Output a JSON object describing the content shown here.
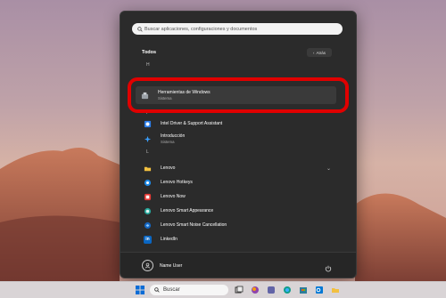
{
  "search": {
    "placeholder": "Buscar aplicaciones, configuraciones y documentos"
  },
  "all_apps": {
    "title": "Todos",
    "back_label": "Atrás"
  },
  "groups": {
    "h_letter": "H",
    "i_letter": "I",
    "l_letter": "L"
  },
  "apps": [
    {
      "name": "Herramientas de Windows",
      "sub": "Sistema",
      "icon": "tools-icon"
    },
    {
      "name": "Intel Driver & Support Assistant",
      "sub": "",
      "icon": "intel-icon"
    },
    {
      "name": "Introducción",
      "sub": "Sistema",
      "icon": "tips-icon"
    },
    {
      "name": "Lenovo",
      "sub": "",
      "icon": "folder-icon"
    },
    {
      "name": "Lenovo Hotkeys",
      "sub": "",
      "icon": "hotkeys-icon"
    },
    {
      "name": "Lenovo Now",
      "sub": "",
      "icon": "lenovo-now-icon"
    },
    {
      "name": "Lenovo Smart Appearance",
      "sub": "",
      "icon": "smart-appearance-icon"
    },
    {
      "name": "Lenovo Smart Noise Cancellation",
      "sub": "",
      "icon": "noise-cancel-icon"
    },
    {
      "name": "LinkedIn",
      "sub": "",
      "icon": "linkedin-icon"
    }
  ],
  "user": {
    "name": "Name User"
  },
  "taskbar": {
    "search_label": "Buscar"
  },
  "colors": {
    "highlight_ring": "#e00000",
    "panel": "#2b2b2b"
  }
}
